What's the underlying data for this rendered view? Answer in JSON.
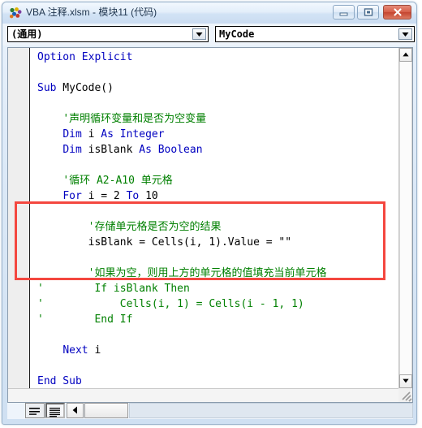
{
  "window": {
    "title": "VBA 注释.xlsm - 模块11 (代码)",
    "icon": "vba-module-icon",
    "controls": {
      "minimize_label": "最小化",
      "maximize_label": "还原",
      "close_label": "关闭"
    }
  },
  "toolbar": {
    "object_combo": {
      "name": "object-dropdown",
      "value": "(通用)",
      "arrow_icon": "chevron-down-icon"
    },
    "procedure_combo": {
      "name": "procedure-dropdown",
      "value": "MyCode",
      "arrow_icon": "chevron-down-icon"
    }
  },
  "editor": {
    "code_lines": [
      {
        "indent": 0,
        "segments": [
          {
            "t": "Option Explicit",
            "c": "kw"
          }
        ]
      },
      {
        "indent": 0,
        "segments": []
      },
      {
        "indent": 0,
        "segments": [
          {
            "t": "Sub",
            "c": "kw"
          },
          {
            "t": " MyCode()",
            "c": "pln"
          }
        ]
      },
      {
        "indent": 0,
        "segments": []
      },
      {
        "indent": 4,
        "segments": [
          {
            "t": "'声明循环变量和是否为空变量",
            "c": "cmt"
          }
        ]
      },
      {
        "indent": 4,
        "segments": [
          {
            "t": "Dim",
            "c": "kw"
          },
          {
            "t": " i ",
            "c": "pln"
          },
          {
            "t": "As",
            "c": "kw"
          },
          {
            "t": " ",
            "c": "pln"
          },
          {
            "t": "Integer",
            "c": "kw"
          }
        ]
      },
      {
        "indent": 4,
        "segments": [
          {
            "t": "Dim",
            "c": "kw"
          },
          {
            "t": " isBlank ",
            "c": "pln"
          },
          {
            "t": "As",
            "c": "kw"
          },
          {
            "t": " ",
            "c": "pln"
          },
          {
            "t": "Boolean",
            "c": "kw"
          }
        ]
      },
      {
        "indent": 0,
        "segments": []
      },
      {
        "indent": 4,
        "segments": [
          {
            "t": "'循环 A2-A10 单元格",
            "c": "cmt"
          }
        ]
      },
      {
        "indent": 4,
        "segments": [
          {
            "t": "For",
            "c": "kw"
          },
          {
            "t": " i = 2 ",
            "c": "pln"
          },
          {
            "t": "To",
            "c": "kw"
          },
          {
            "t": " 10",
            "c": "pln"
          }
        ]
      },
      {
        "indent": 0,
        "segments": []
      },
      {
        "indent": 8,
        "segments": [
          {
            "t": "'存储单元格是否为空的结果",
            "c": "cmt"
          }
        ]
      },
      {
        "indent": 8,
        "segments": [
          {
            "t": "isBlank = Cells(i, 1).Value = \"\"",
            "c": "pln"
          }
        ]
      },
      {
        "indent": 0,
        "segments": []
      },
      {
        "indent": 8,
        "segments": [
          {
            "t": "'如果为空，则用上方的单元格的值填充当前单元格",
            "c": "cmt"
          }
        ]
      },
      {
        "indent": 0,
        "segments": [
          {
            "t": "'        If isBlank Then",
            "c": "cmt"
          }
        ]
      },
      {
        "indent": 0,
        "segments": [
          {
            "t": "'            Cells(i, 1) = Cells(i - 1, 1)",
            "c": "cmt"
          }
        ]
      },
      {
        "indent": 0,
        "segments": [
          {
            "t": "'        End If",
            "c": "cmt"
          }
        ]
      },
      {
        "indent": 0,
        "segments": []
      },
      {
        "indent": 4,
        "segments": [
          {
            "t": "Next",
            "c": "kw"
          },
          {
            "t": " i",
            "c": "pln"
          }
        ]
      },
      {
        "indent": 0,
        "segments": []
      },
      {
        "indent": 0,
        "segments": [
          {
            "t": "End Sub",
            "c": "kw"
          }
        ]
      }
    ],
    "annotation": {
      "name": "red-highlight-box",
      "color": "#f4473f",
      "covers_lines": "commented-out If block"
    }
  },
  "scrollbars": {
    "vertical": {
      "up_icon": "triangle-up-icon",
      "down_icon": "triangle-down-icon"
    },
    "horizontal": {
      "left_icon": "triangle-left-icon"
    },
    "resize_grip_icon": "resize-grip-icon"
  },
  "status_bar": {
    "procedure_view_button": {
      "name": "procedure-view-button",
      "icon": "procedure-view-icon"
    },
    "full_module_view_button": {
      "name": "full-module-view-button",
      "icon": "full-module-view-icon"
    }
  },
  "colors": {
    "keyword": "#0000c0",
    "comment": "#008000",
    "plain": "#000000",
    "annotation": "#f4473f",
    "titlebar_text": "#20364f"
  }
}
